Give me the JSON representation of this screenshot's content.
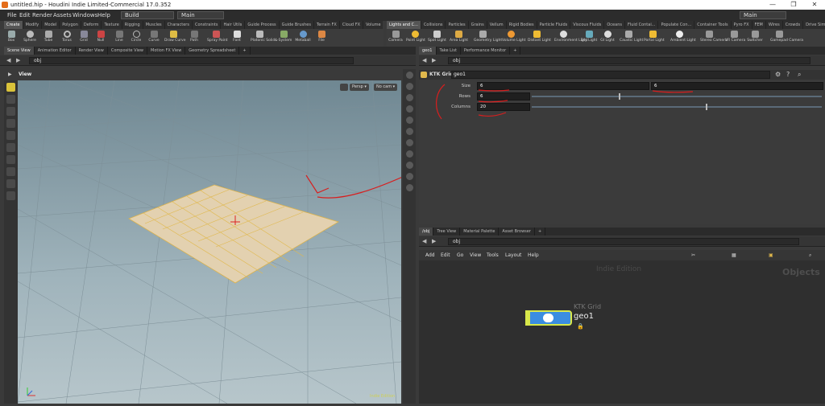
{
  "window": {
    "title": "untitled.hip - Houdini Indie Limited-Commercial 17.0.352",
    "controls": [
      "—",
      "❐",
      "✕"
    ]
  },
  "menu": {
    "items": [
      "File",
      "Edit",
      "Render",
      "Assets",
      "Windows",
      "Help"
    ],
    "build": "Build",
    "desktop": "Main",
    "desktop_right": "Main"
  },
  "shelf_tabs_left": [
    "Create",
    "Modify",
    "Model",
    "Polygon",
    "Deform",
    "Texture",
    "Rigging",
    "Muscles",
    "Characters",
    "Constraints",
    "Hair Utils",
    "Guide Process",
    "Guide Brushes",
    "Terrain FX",
    "Cloud FX",
    "Volume"
  ],
  "shelf_tabs_right": [
    "Lights and C...",
    "Collisions",
    "Particles",
    "Grains",
    "Vellum",
    "Rigid Bodies",
    "Particle Fluids",
    "Viscous Fluids",
    "Oceans",
    "Fluid Contai...",
    "Populate Con...",
    "Container Tools",
    "Pyro FX",
    "FEM",
    "Wires",
    "Crowds",
    "Drive Simula..."
  ],
  "tools_left": [
    "Box",
    "Sphere",
    "Tube",
    "Torus",
    "Grid",
    "Null",
    "Line",
    "Circle",
    "Curve",
    "Draw Curve",
    "Path",
    "Spray Paint",
    "Font",
    "Platonic Solids",
    "L-System",
    "Metaball",
    "File"
  ],
  "tools_right": [
    "Camera",
    "Point Light",
    "Spot Light",
    "Area Light",
    "Geometry Light",
    "Volume Light",
    "Distant Light",
    "Environment Light",
    "Sky Light",
    "GI Light",
    "Caustic Light",
    "Portal Light",
    "Ambient Light",
    "Stereo Camera",
    "VR Camera",
    "Switcher",
    "Gamepad Camera"
  ],
  "left_pane_tabs": [
    "Scene View",
    "Animation Editor",
    "Render View",
    "Composite View",
    "Motion FX View",
    "Geometry Spreadsheet"
  ],
  "right_pane_tabs": [
    "geo1",
    "Take List",
    "Performance Monitor"
  ],
  "path": {
    "left": "obj",
    "right": "obj",
    "net": "obj"
  },
  "viewport": {
    "label": "View",
    "persp": "Persp ▾",
    "cam": "No cam ▾",
    "edition": "Indie Edition"
  },
  "params": {
    "node_type": "KTK Grid",
    "node_name": "geo1",
    "size_label": "Size",
    "size_x": "6",
    "size_y": "6",
    "rows_label": "Rows",
    "rows": "6",
    "cols_label": "Columns",
    "cols": "20",
    "rows_fill": 0.3,
    "cols_fill": 0.6
  },
  "net_tabs": [
    "/obj",
    "Tree View",
    "Material Palette",
    "Asset Browser"
  ],
  "net_menu": [
    "Add",
    "Edit",
    "Go",
    "View",
    "Tools",
    "Layout",
    "Help"
  ],
  "network": {
    "edition": "Indie Edition",
    "context": "Objects",
    "node_type": "KTK Grid",
    "node_name": "geo1"
  },
  "colors": {
    "accent": "#e46d1b",
    "node": "#3b8de0",
    "node_outline": "#d8e84a",
    "annotation": "#d81e1e"
  }
}
